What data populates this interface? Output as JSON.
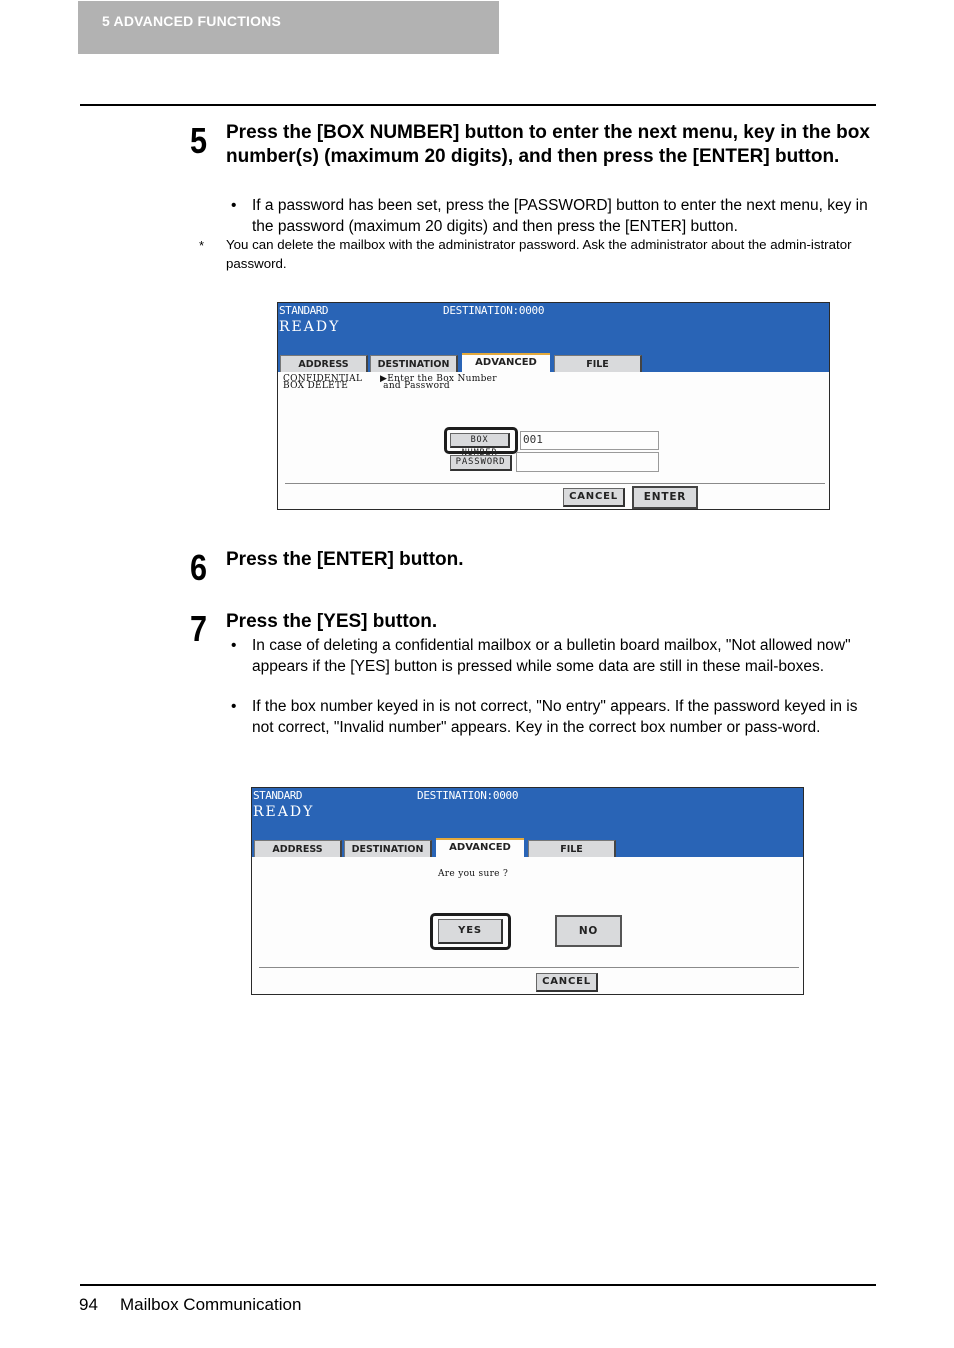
{
  "header": {
    "chapter_label": "5   ADVANCED FUNCTIONS"
  },
  "steps": [
    {
      "number": "5",
      "title": "Press the [BOX NUMBER] button to enter the next menu, key in the box number(s) (maximum 20 digits), and then press the [ENTER] button.",
      "bullets": [
        "If a password has been set, press the [PASSWORD] button to enter the next menu, key in the password (maximum 20 digits) and then press the [ENTER] button."
      ],
      "note_marker": "*",
      "note": "You can delete the mailbox with the administrator password. Ask the administrator about the admin-istrator password."
    },
    {
      "number": "6",
      "title": "Press the [ENTER] button."
    },
    {
      "number": "7",
      "title": "Press the [YES] button.",
      "bullets": [
        "In case of deleting a confidential mailbox or a bulletin board mailbox, \"Not allowed now\" appears if the [YES] button is pressed while some data are still in these mail-boxes.",
        "If the box number keyed in is not correct, \"No entry\" appears. If the password keyed in is not correct, \"Invalid number\" appears. Key in the correct box number or pass-word."
      ]
    }
  ],
  "bullet_glyph": "•",
  "screen1": {
    "mode": "STANDARD",
    "destination": "DESTINATION:0000",
    "status": "READY",
    "tabs": [
      "ADDRESS",
      "DESTINATION",
      "ADVANCED",
      "FILE"
    ],
    "active_tab": "ADVANCED",
    "menu_line1": "CONFIDENTIAL",
    "menu_line2": "BOX DELETE",
    "prompt_line1": "▶Enter the Box Number",
    "prompt_line2": " and Password",
    "box_number_label": "BOX NUMBER",
    "box_number_value": "001",
    "password_label": "PASSWORD",
    "password_value": "",
    "cancel_label": "CANCEL",
    "enter_label": "ENTER"
  },
  "screen2": {
    "mode": "STANDARD",
    "destination": "DESTINATION:0000",
    "status": "READY",
    "tabs": [
      "ADDRESS",
      "DESTINATION",
      "ADVANCED",
      "FILE"
    ],
    "active_tab": "ADVANCED",
    "question": "Are you sure ?",
    "yes_label": "YES",
    "no_label": "NO",
    "cancel_label": "CANCEL"
  },
  "footer": {
    "page_number": "94",
    "section_title": "Mailbox Communication"
  }
}
